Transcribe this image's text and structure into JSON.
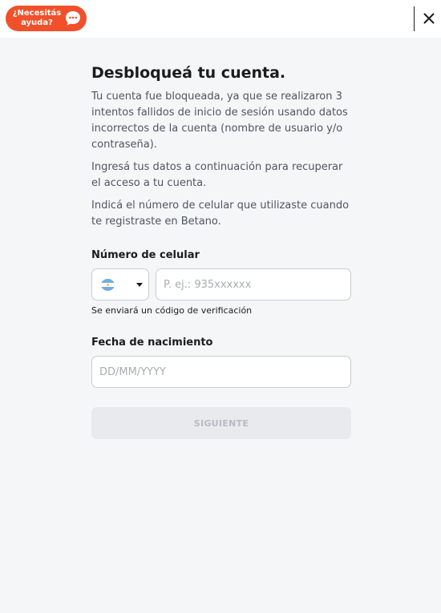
{
  "header": {
    "help_line1": "¿Necesitás",
    "help_line2": "ayuda?",
    "help_icon": "chat-bubble-icon",
    "close_icon": "close-icon",
    "accent_color": "#f0502a"
  },
  "main": {
    "title": "Desbloqueá tu cuenta.",
    "paragraphs": [
      "Tu cuenta fue bloqueada, ya que se realizaron 3 intentos fallidos de inicio de sesión usando datos incorrectos de la cuenta (nombre de usuario y/o contraseña).",
      "Ingresá tus datos a continuación para recuperar el acceso a tu cuenta.",
      "Indicá el número de celular que utilizaste cuando te registraste en Betano."
    ]
  },
  "phone": {
    "label": "Número de celular",
    "country_flag": "argentina-flag-icon",
    "placeholder": "P. ej.: 935xxxxxx",
    "hint": "Se enviará un código de verificación"
  },
  "birthdate": {
    "label": "Fecha de nacimiento",
    "placeholder": "DD/MM/YYYY"
  },
  "submit": {
    "label": "SIGUIENTE",
    "state": "disabled"
  }
}
